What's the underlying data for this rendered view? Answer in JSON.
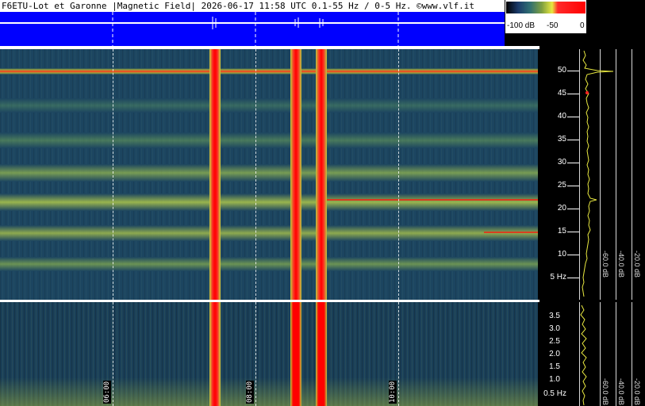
{
  "header": {
    "title": "F6ETU-Lot et Garonne |Magnetic Field| 2026-06-17 11:58 UTC 0.1-55 Hz / 0-5 Hz. ©www.vlf.it"
  },
  "colorscale": {
    "labels": [
      "-100 dB",
      "-50",
      "0"
    ]
  },
  "upper_axis": {
    "ticks": [
      "50",
      "45",
      "40",
      "35",
      "30",
      "25",
      "20",
      "15",
      "10",
      "5 Hz"
    ],
    "db_labels": [
      "-60.0 dB",
      "-40.0 dB",
      "-20.0 dB"
    ]
  },
  "lower_axis": {
    "ticks": [
      "3.5",
      "3.0",
      "2.5",
      "2.0",
      "1.5",
      "1.0",
      "0.5 Hz"
    ],
    "db_labels": [
      "-60.0 dB",
      "-40.0 dB",
      "-20.0 dB"
    ]
  },
  "time_marks": [
    "06:00",
    "08:00",
    "10:00"
  ],
  "colors": {
    "spectrogram_bg": "#1c4560",
    "band": "#b8c850",
    "hot": "#ff0000",
    "header_strip": "#0000ff"
  }
}
